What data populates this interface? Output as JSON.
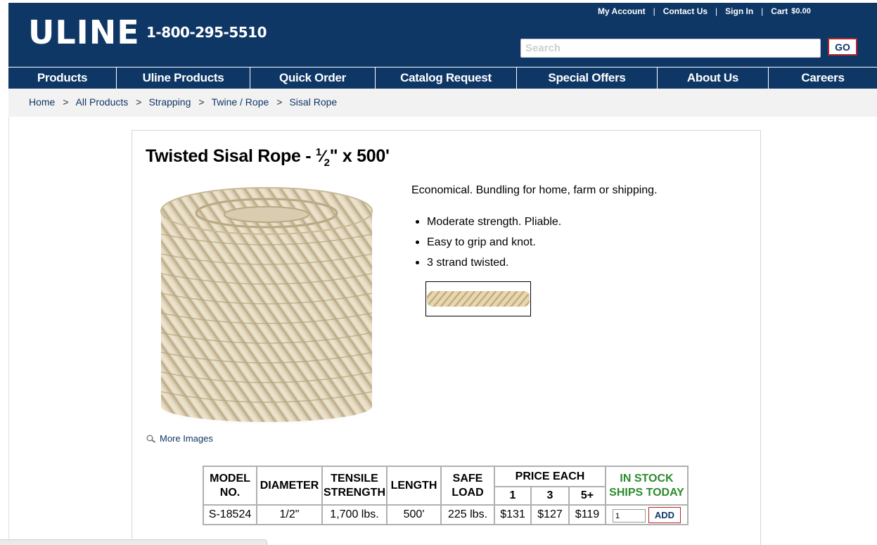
{
  "header": {
    "logo": "ULINE",
    "phone": "1-800-295-5510",
    "links": [
      "My Account",
      "Contact Us",
      "Sign In",
      "Cart"
    ],
    "cart_amount": "$0.00",
    "search_placeholder": "Search",
    "go_label": "GO",
    "colors": {
      "brand": "#0e3766",
      "accent": "#b3262b"
    }
  },
  "nav": {
    "items": [
      "Products",
      "Uline Products",
      "Quick Order",
      "Catalog Request",
      "Special Offers",
      "About Us",
      "Careers"
    ]
  },
  "breadcrumb": {
    "items": [
      "Home",
      "All Products",
      "Strapping",
      "Twine / Rope",
      "Sisal Rope"
    ],
    "separator": ">"
  },
  "product": {
    "title_prefix": "Twisted Sisal Rope -",
    "title_fraction_num": "1",
    "title_fraction_den": "2",
    "title_suffix": "\" x 500'",
    "description": "Economical. Bundling for home, farm or shipping.",
    "bullets": [
      "Moderate strength. Pliable.",
      "Easy to grip and knot.",
      "3 strand twisted."
    ],
    "more_images": "More Images"
  },
  "table": {
    "headers": {
      "model_1": "MODEL",
      "model_2": "NO.",
      "diameter": "DIAMETER",
      "tensile_1": "TENSILE",
      "tensile_2": "STRENGTH",
      "length": "LENGTH",
      "safe_1": "SAFE",
      "safe_2": "LOAD",
      "price_each": "PRICE EACH",
      "tier_1": "1",
      "tier_2": "3",
      "tier_3": "5+",
      "stock_1": "IN STOCK",
      "stock_2": "SHIPS TODAY"
    },
    "row": {
      "model": "S-18524",
      "diameter": "1/2\"",
      "tensile": "1,700 lbs.",
      "length": "500'",
      "safe_load": "225 lbs.",
      "price_1": "$131",
      "price_3": "$127",
      "price_5": "$119",
      "qty_value": "1",
      "add_label": "ADD"
    }
  }
}
